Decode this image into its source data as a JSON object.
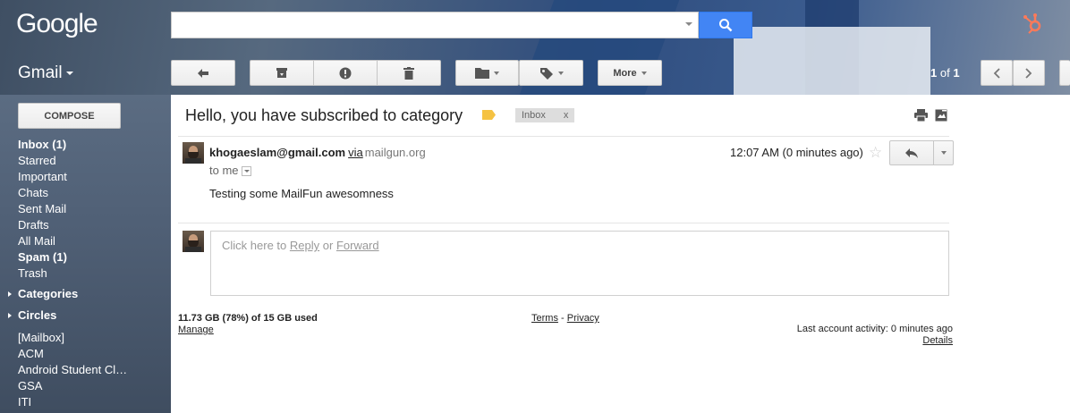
{
  "header": {
    "logo": "Google",
    "search_placeholder": "",
    "app_label": "Gmail"
  },
  "toolbar": {
    "more_label": "More",
    "pager_current": "1",
    "pager_of": "of",
    "pager_total": "1"
  },
  "sidebar": {
    "compose_label": "COMPOSE",
    "items": [
      {
        "label": "Inbox (1)",
        "bold": true
      },
      {
        "label": "Starred",
        "bold": false
      },
      {
        "label": "Important",
        "bold": false
      },
      {
        "label": "Chats",
        "bold": false
      },
      {
        "label": "Sent Mail",
        "bold": false
      },
      {
        "label": "Drafts",
        "bold": false
      },
      {
        "label": "All Mail",
        "bold": false
      },
      {
        "label": "Spam (1)",
        "bold": true
      },
      {
        "label": "Trash",
        "bold": false
      }
    ],
    "categories_label": "Categories",
    "circles_label": "Circles",
    "labels": [
      {
        "label": "[Mailbox]"
      },
      {
        "label": "ACM"
      },
      {
        "label": "Android Student Cl…"
      },
      {
        "label": "GSA"
      },
      {
        "label": "ITI"
      }
    ]
  },
  "message": {
    "subject": "Hello, you have subscribed to category",
    "tag": "Inbox",
    "tag_close": "x",
    "sender_email": "khogaeslam@gmail.com",
    "via": "via",
    "via_domain": "mailgun.org",
    "to": "to me",
    "timestamp": "12:07 AM (0 minutes ago)",
    "body": "Testing some MailFun awesomness"
  },
  "reply_box": {
    "prefix": "Click here to",
    "reply": "Reply",
    "or": "or",
    "forward": "Forward"
  },
  "footer": {
    "storage": "11.73 GB (78%) of 15 GB used",
    "manage": "Manage",
    "terms": "Terms",
    "dash": "-",
    "privacy": "Privacy",
    "activity": "Last account activity: 0 minutes ago",
    "details": "Details"
  },
  "colors": {
    "search_blue": "#4285f4",
    "hubspot_orange": "#ff7a59",
    "label_yellow": "#f5c242"
  }
}
